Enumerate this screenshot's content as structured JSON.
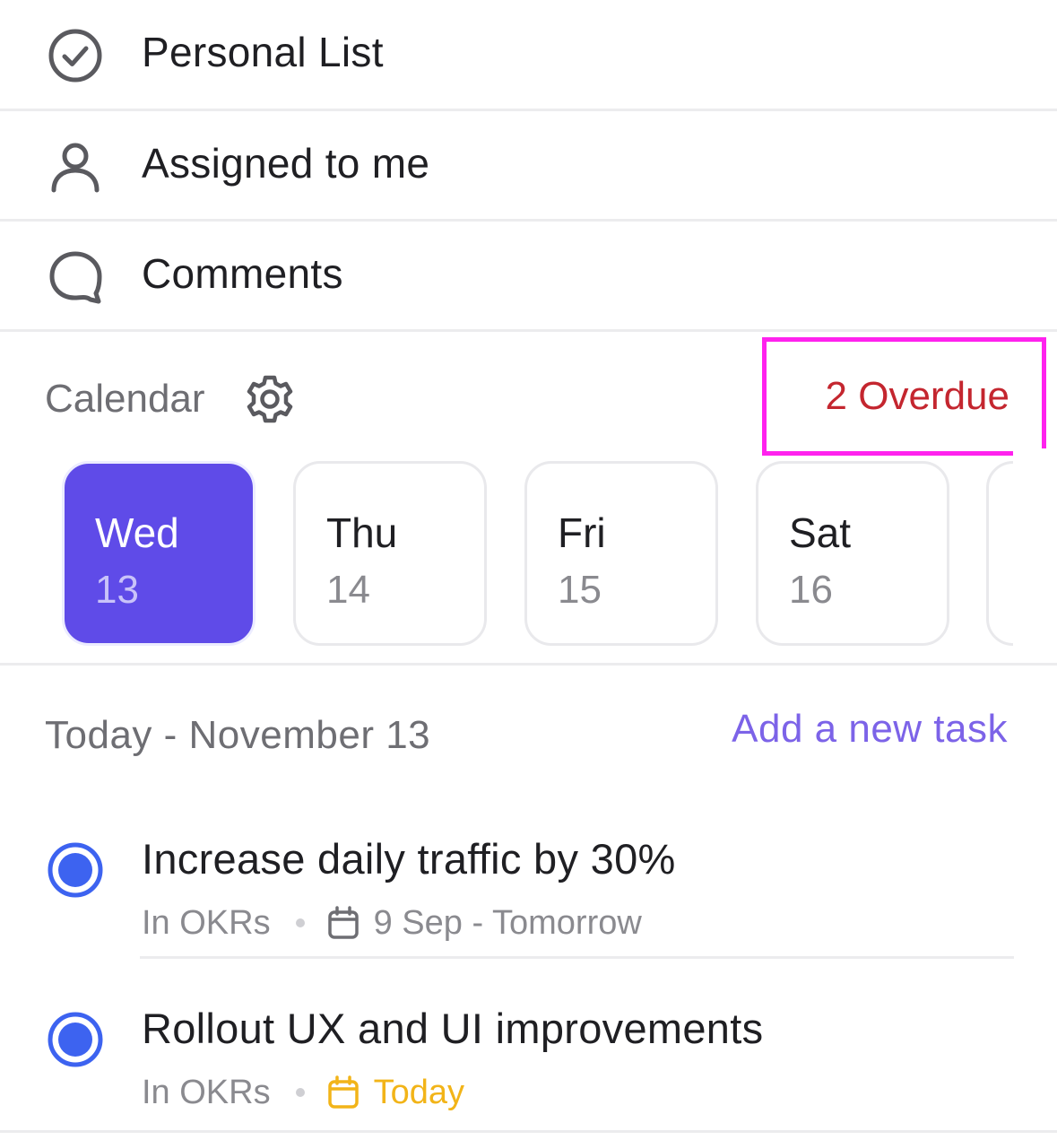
{
  "nav": {
    "items": [
      {
        "label": "Personal List",
        "icon": "check-circle-icon"
      },
      {
        "label": "Assigned to me",
        "icon": "person-icon"
      },
      {
        "label": "Comments",
        "icon": "comment-bubble-icon"
      }
    ]
  },
  "calendar": {
    "title": "Calendar",
    "settings_icon": "gear-icon",
    "overdue_label": "2 Overdue",
    "days": [
      {
        "name": "Wed",
        "num": "13",
        "selected": true
      },
      {
        "name": "Thu",
        "num": "14",
        "selected": false
      },
      {
        "name": "Fri",
        "num": "15",
        "selected": false
      },
      {
        "name": "Sat",
        "num": "16",
        "selected": false
      }
    ]
  },
  "today": {
    "title": "Today - November 13",
    "add_task_label": "Add a new task",
    "tasks": [
      {
        "title": "Increase daily traffic by 30%",
        "list": "In OKRs",
        "due": "9 Sep - Tomorrow"
      },
      {
        "title": "Rollout UX and UI improvements",
        "list": "In OKRs",
        "due": "Today"
      }
    ]
  },
  "colors": {
    "accent": "#5f4be8",
    "link": "#7c63e8",
    "overdue": "#c4262f",
    "radio": "#3d63f0",
    "today_due": "#f2b418",
    "highlight_box": "#ff22ee"
  }
}
